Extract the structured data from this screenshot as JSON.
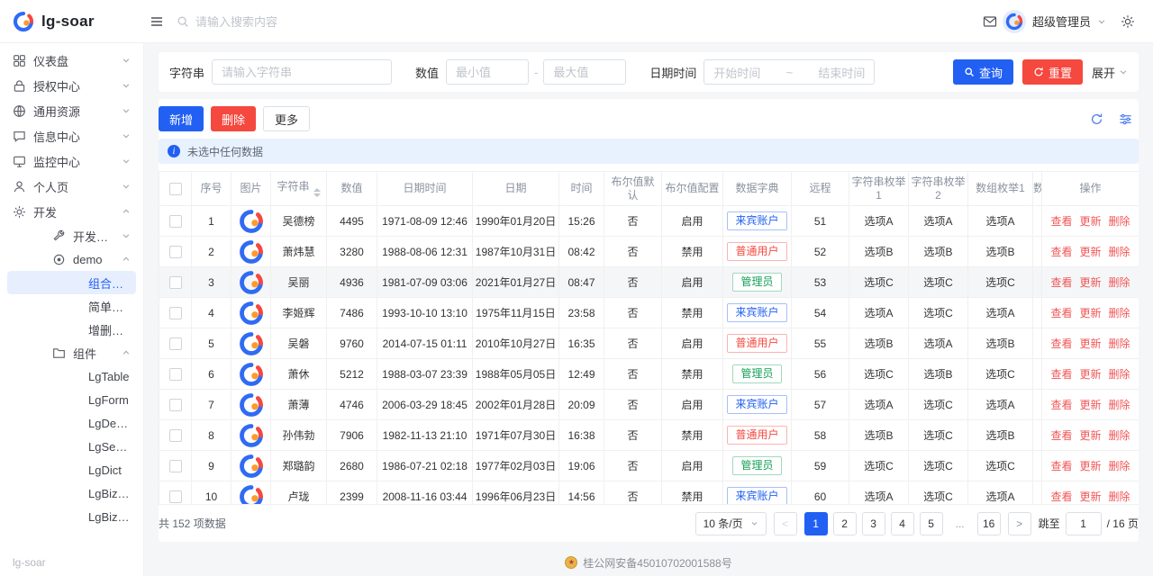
{
  "header": {
    "logo": "lg-soar",
    "search_placeholder": "请输入搜索内容",
    "user_name": "超级管理员"
  },
  "icons": {
    "menu": "☰",
    "search": "🔍",
    "mail": "✉",
    "settings": "⚙",
    "refresh": "⟳",
    "column-settings": "☷",
    "info": "i",
    "chevron-down": "∨",
    "chevron-up": "∧",
    "beian-badge": "★"
  },
  "sidebar": {
    "items": [
      "仪表盘",
      "授权中心",
      "通用资源",
      "信息中心",
      "监控中心",
      "个人页",
      "开发"
    ],
    "dev_tools": "开发工具",
    "demo_label": "demo",
    "demo_children": [
      "组合页面",
      "简单页面",
      "增删改查"
    ],
    "active_item": "组合页面",
    "components_label": "组件",
    "component_children": [
      "LgTable",
      "LgForm",
      "LgDescription",
      "LgSearchBar",
      "LgDict",
      "LgBizSelect",
      "LgBizTree"
    ],
    "footer": "lg-soar"
  },
  "search": {
    "string_label": "字符串",
    "string_placeholder": "请输入字符串",
    "number_label": "数值",
    "min_placeholder": "最小值",
    "max_placeholder": "最大值",
    "number_separator": "-",
    "date_label": "日期时间",
    "start_placeholder": "开始时间",
    "end_placeholder": "结束时间",
    "date_separator": "~",
    "query_button": "查询",
    "reset_button": "重置",
    "expand_label": "展开"
  },
  "toolbar": {
    "add": "新增",
    "delete": "删除",
    "more": "更多"
  },
  "alert": {
    "text": "未选中任何数据"
  },
  "table": {
    "columns": [
      "序号",
      "图片",
      "字符串",
      "数值",
      "日期时间",
      "日期",
      "时间",
      "布尔值默认",
      "布尔值配置",
      "数据字典",
      "远程",
      "字符串枚举1",
      "字符串枚举2",
      "数组枚举1",
      "数",
      "操作"
    ],
    "actions": [
      "查看",
      "更新",
      "删除"
    ],
    "badge_colors": {
      "来宾账户": "blue",
      "普通用户": "red",
      "管理员": "green"
    },
    "hover_row_index": 2,
    "rows": [
      {
        "no": 1,
        "name": "吴德榜",
        "num": 4495,
        "datetime": "1971-08-09 12:46",
        "date": "1990年01月20日",
        "time": "15:26",
        "bool_default": "否",
        "bool_config": "启用",
        "dict": "来宾账户",
        "remote": 51,
        "enum1": "选项A",
        "enum2": "选项A",
        "arr1": "选项A"
      },
      {
        "no": 2,
        "name": "萧炜慧",
        "num": 3280,
        "datetime": "1988-08-06 12:31",
        "date": "1987年10月31日",
        "time": "08:42",
        "bool_default": "否",
        "bool_config": "禁用",
        "dict": "普通用户",
        "remote": 52,
        "enum1": "选项B",
        "enum2": "选项B",
        "arr1": "选项B"
      },
      {
        "no": 3,
        "name": "吴丽",
        "num": 4936,
        "datetime": "1981-07-09 03:06",
        "date": "2021年01月27日",
        "time": "08:47",
        "bool_default": "否",
        "bool_config": "启用",
        "dict": "管理员",
        "remote": 53,
        "enum1": "选项C",
        "enum2": "选项C",
        "arr1": "选项C"
      },
      {
        "no": 4,
        "name": "李姬辉",
        "num": 7486,
        "datetime": "1993-10-10 13:10",
        "date": "1975年11月15日",
        "time": "23:58",
        "bool_default": "否",
        "bool_config": "禁用",
        "dict": "来宾账户",
        "remote": 54,
        "enum1": "选项A",
        "enum2": "选项C",
        "arr1": "选项A"
      },
      {
        "no": 5,
        "name": "吴磐",
        "num": 9760,
        "datetime": "2014-07-15 01:11",
        "date": "2010年10月27日",
        "time": "16:35",
        "bool_default": "否",
        "bool_config": "启用",
        "dict": "普通用户",
        "remote": 55,
        "enum1": "选项B",
        "enum2": "选项A",
        "arr1": "选项B"
      },
      {
        "no": 6,
        "name": "萧休",
        "num": 5212,
        "datetime": "1988-03-07 23:39",
        "date": "1988年05月05日",
        "time": "12:49",
        "bool_default": "否",
        "bool_config": "禁用",
        "dict": "管理员",
        "remote": 56,
        "enum1": "选项C",
        "enum2": "选项B",
        "arr1": "选项C"
      },
      {
        "no": 7,
        "name": "萧薄",
        "num": 4746,
        "datetime": "2006-03-29 18:45",
        "date": "2002年01月28日",
        "time": "20:09",
        "bool_default": "否",
        "bool_config": "启用",
        "dict": "来宾账户",
        "remote": 57,
        "enum1": "选项A",
        "enum2": "选项C",
        "arr1": "选项A"
      },
      {
        "no": 8,
        "name": "孙伟勃",
        "num": 7906,
        "datetime": "1982-11-13 21:10",
        "date": "1971年07月30日",
        "time": "16:38",
        "bool_default": "否",
        "bool_config": "禁用",
        "dict": "普通用户",
        "remote": 58,
        "enum1": "选项B",
        "enum2": "选项C",
        "arr1": "选项B"
      },
      {
        "no": 9,
        "name": "郑璐韵",
        "num": 2680,
        "datetime": "1986-07-21 02:18",
        "date": "1977年02月03日",
        "time": "19:06",
        "bool_default": "否",
        "bool_config": "启用",
        "dict": "管理员",
        "remote": 59,
        "enum1": "选项C",
        "enum2": "选项C",
        "arr1": "选项C"
      },
      {
        "no": 10,
        "name": "卢珑",
        "num": 2399,
        "datetime": "2008-11-16 03:44",
        "date": "1996年06月23日",
        "time": "14:56",
        "bool_default": "否",
        "bool_config": "禁用",
        "dict": "来宾账户",
        "remote": 60,
        "enum1": "选项A",
        "enum2": "选项C",
        "arr1": "选项A"
      }
    ]
  },
  "pagination": {
    "total_text": "共 152 项数据",
    "page_size": "10 条/页",
    "pages": [
      "1",
      "2",
      "3",
      "4",
      "5",
      "...",
      "16"
    ],
    "active_page": "1",
    "jump_label": "跳至",
    "jump_value": "1",
    "jump_suffix": "/ 16 页"
  },
  "footer": {
    "beian_text": "桂公网安备45010702001588号"
  },
  "colors": {
    "primary": "#2160f3",
    "danger": "#f5483f",
    "success": "#18a058",
    "active_menu_bg": "#e7efff",
    "alert_bg": "#e8f1fe"
  }
}
